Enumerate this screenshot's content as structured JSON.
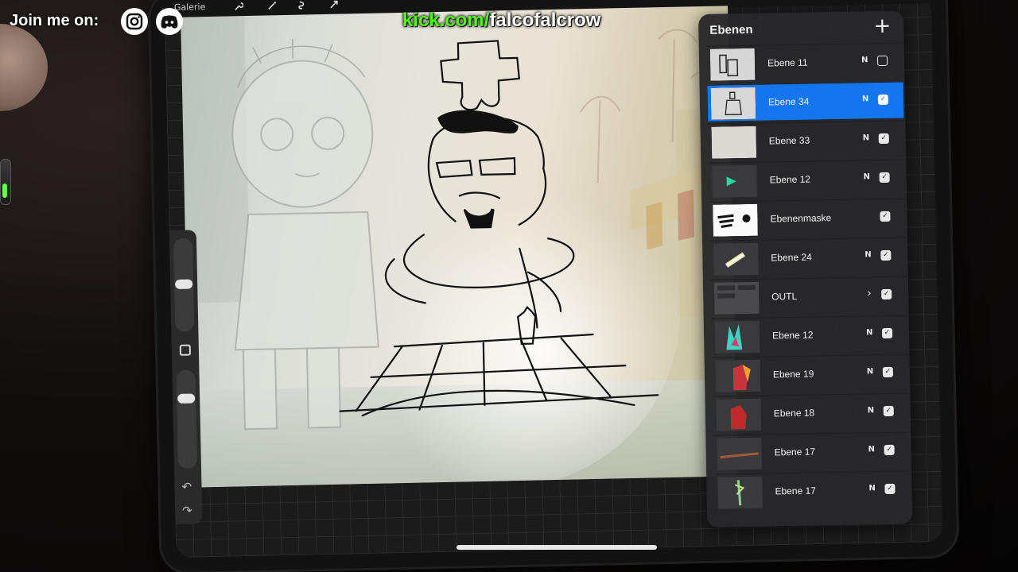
{
  "overlay": {
    "join_text": "Join me on:",
    "social_icons": [
      "instagram-icon",
      "discord-icon"
    ],
    "kick_domain": "kick.com/",
    "kick_channel": "falcofalcrow",
    "kick_color": "#53fc18"
  },
  "toolbar": {
    "gallery_label": "Galerie",
    "tools": [
      "wrench-icon",
      "magic-wand-icon",
      "selection-icon",
      "transform-arrow-icon"
    ]
  },
  "sidebar": {
    "undo_icon": "↶",
    "redo_icon": "↷"
  },
  "layers_panel": {
    "title": "Ebenen",
    "add_icon": "+",
    "accent": "#1376ee",
    "layers": [
      {
        "name": "Ebene 11",
        "mode": "N",
        "checked": false,
        "active": false
      },
      {
        "name": "Ebene 34",
        "mode": "N",
        "checked": true,
        "active": true
      },
      {
        "name": "Ebene 33",
        "mode": "N",
        "checked": true,
        "active": false
      },
      {
        "name": "Ebene 12",
        "mode": "N",
        "checked": true,
        "active": false
      },
      {
        "name": "Ebenenmaske",
        "mode": "",
        "checked": true,
        "active": false
      },
      {
        "name": "Ebene 24",
        "mode": "N",
        "checked": true,
        "active": false
      },
      {
        "name": "OUTL",
        "mode": "›",
        "checked": true,
        "active": false
      },
      {
        "name": "Ebene 12",
        "mode": "N",
        "checked": true,
        "active": false
      },
      {
        "name": "Ebene 19",
        "mode": "N",
        "checked": true,
        "active": false
      },
      {
        "name": "Ebene 18",
        "mode": "N",
        "checked": true,
        "active": false
      },
      {
        "name": "Ebene 17",
        "mode": "N",
        "checked": true,
        "active": false
      },
      {
        "name": "Ebene 17",
        "mode": "N",
        "checked": true,
        "active": false
      }
    ]
  }
}
